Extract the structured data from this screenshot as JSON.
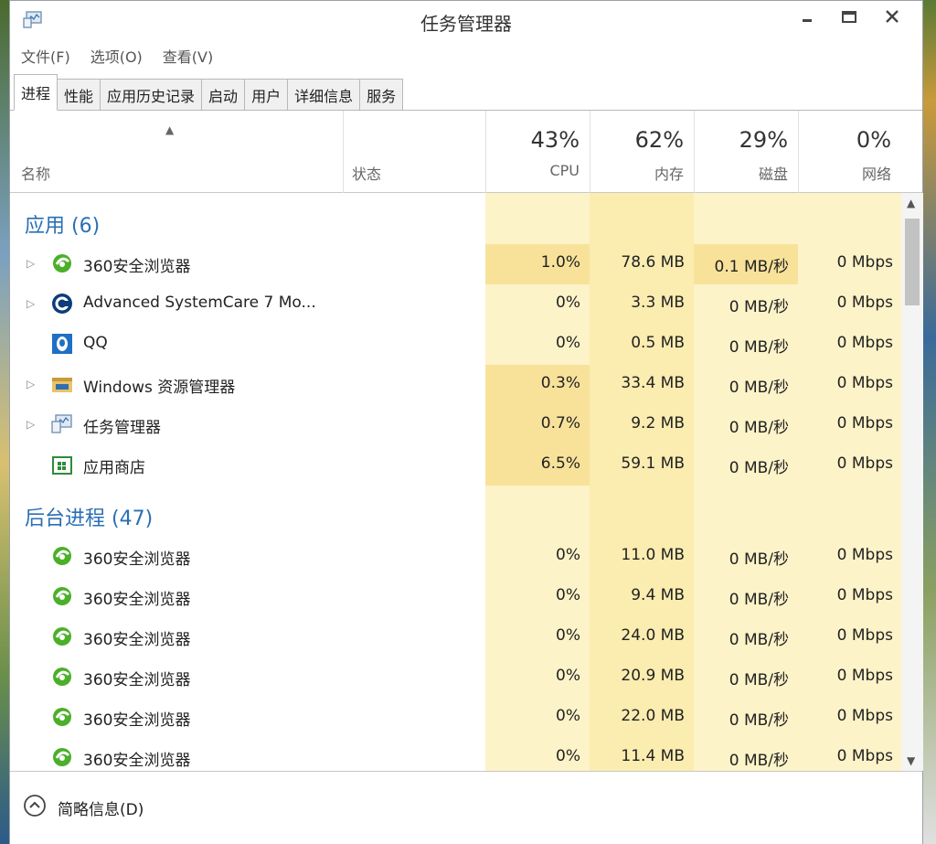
{
  "window": {
    "title": "任务管理器",
    "minimize_icon": "minimize-icon",
    "maximize_icon": "maximize-icon",
    "close_icon": "close-icon",
    "app_icon": "task-manager-icon"
  },
  "menu": [
    {
      "label": "文件(F)"
    },
    {
      "label": "选项(O)"
    },
    {
      "label": "查看(V)"
    }
  ],
  "tabs": [
    {
      "label": "进程",
      "active": true
    },
    {
      "label": "性能"
    },
    {
      "label": "应用历史记录"
    },
    {
      "label": "启动"
    },
    {
      "label": "用户"
    },
    {
      "label": "详细信息"
    },
    {
      "label": "服务"
    }
  ],
  "columns": {
    "name": "名称",
    "status": "状态",
    "cpu": {
      "percent": "43%",
      "label": "CPU"
    },
    "memory": {
      "percent": "62%",
      "label": "内存"
    },
    "disk": {
      "percent": "29%",
      "label": "磁盘"
    },
    "network": {
      "percent": "0%",
      "label": "网络"
    }
  },
  "groups": {
    "apps": {
      "title": "应用 (6)",
      "rows": [
        {
          "name": "360安全浏览器",
          "icon": "360-browser-icon",
          "expandable": true,
          "cpu": "1.0%",
          "memory": "78.6 MB",
          "disk": "0.1 MB/秒",
          "network": "0 Mbps"
        },
        {
          "name": "Advanced SystemCare 7 Mo...",
          "icon": "advanced-systemcare-icon",
          "expandable": true,
          "cpu": "0%",
          "memory": "3.3 MB",
          "disk": "0 MB/秒",
          "network": "0 Mbps"
        },
        {
          "name": "QQ",
          "icon": "qq-icon",
          "expandable": false,
          "cpu": "0%",
          "memory": "0.5 MB",
          "disk": "0 MB/秒",
          "network": "0 Mbps"
        },
        {
          "name": "Windows 资源管理器",
          "icon": "windows-explorer-icon",
          "expandable": true,
          "cpu": "0.3%",
          "memory": "33.4 MB",
          "disk": "0 MB/秒",
          "network": "0 Mbps"
        },
        {
          "name": "任务管理器",
          "icon": "task-manager-icon",
          "expandable": true,
          "cpu": "0.7%",
          "memory": "9.2 MB",
          "disk": "0 MB/秒",
          "network": "0 Mbps"
        },
        {
          "name": "应用商店",
          "icon": "store-icon",
          "expandable": false,
          "cpu": "6.5%",
          "memory": "59.1 MB",
          "disk": "0 MB/秒",
          "network": "0 Mbps"
        }
      ]
    },
    "background": {
      "title": "后台进程 (47)",
      "rows": [
        {
          "name": "360安全浏览器",
          "icon": "360-browser-icon",
          "cpu": "0%",
          "memory": "11.0 MB",
          "disk": "0 MB/秒",
          "network": "0 Mbps"
        },
        {
          "name": "360安全浏览器",
          "icon": "360-browser-icon",
          "cpu": "0%",
          "memory": "9.4 MB",
          "disk": "0 MB/秒",
          "network": "0 Mbps"
        },
        {
          "name": "360安全浏览器",
          "icon": "360-browser-icon",
          "cpu": "0%",
          "memory": "24.0 MB",
          "disk": "0 MB/秒",
          "network": "0 Mbps"
        },
        {
          "name": "360安全浏览器",
          "icon": "360-browser-icon",
          "cpu": "0%",
          "memory": "20.9 MB",
          "disk": "0 MB/秒",
          "network": "0 Mbps"
        },
        {
          "name": "360安全浏览器",
          "icon": "360-browser-icon",
          "cpu": "0%",
          "memory": "22.0 MB",
          "disk": "0 MB/秒",
          "network": "0 Mbps"
        },
        {
          "name": "360安全浏览器",
          "icon": "360-browser-icon",
          "cpu": "0%",
          "memory": "11.4 MB",
          "disk": "0 MB/秒",
          "network": "0 Mbps"
        }
      ]
    }
  },
  "footer": {
    "label": "简略信息(D)",
    "icon": "chevron-up-circle-icon"
  },
  "colors": {
    "group_title": "#2a6fb5",
    "heat_light": "#fff4c4",
    "heat_medium": "#fbe9a4",
    "heat_strong": "#f6de8a"
  }
}
